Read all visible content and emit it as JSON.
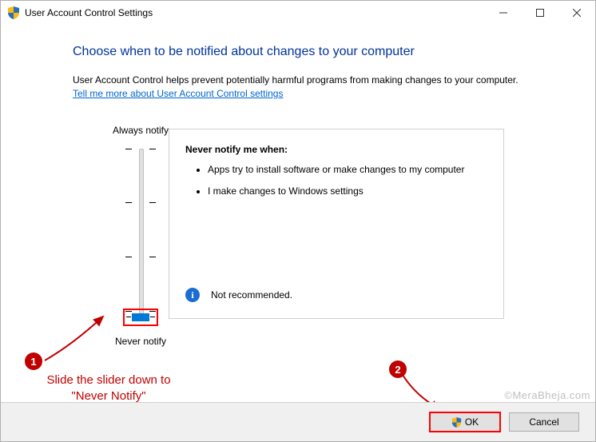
{
  "window": {
    "title": "User Account Control Settings"
  },
  "heading": "Choose when to be notified about changes to your computer",
  "description": "User Account Control helps prevent potentially harmful programs from making changes to your computer.",
  "link_text": "Tell me more about User Account Control settings",
  "slider": {
    "top_label": "Always notify",
    "bottom_label": "Never notify"
  },
  "panel": {
    "title": "Never notify me when:",
    "items": [
      "Apps try to install software or make changes to my computer",
      "I make changes to Windows settings"
    ],
    "recommendation": "Not recommended."
  },
  "annotations": {
    "one": "1",
    "two": "2",
    "text_line1": "Slide the slider down to",
    "text_line2": "\"Never Notify\""
  },
  "buttons": {
    "ok": "OK",
    "cancel": "Cancel"
  },
  "watermark": "©MeraBheja.com"
}
